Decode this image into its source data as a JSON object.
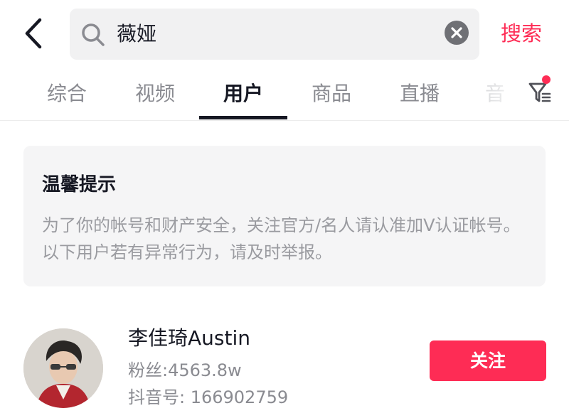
{
  "header": {
    "back_icon": "chevron-left-icon",
    "search": {
      "icon": "search-icon",
      "query": "薇娅",
      "clear_icon": "clear-circle-icon"
    },
    "submit_label": "搜索",
    "accent_color": "#fe2c55"
  },
  "tabs": {
    "items": [
      {
        "label": "综合",
        "active": false
      },
      {
        "label": "视频",
        "active": false
      },
      {
        "label": "用户",
        "active": true
      },
      {
        "label": "商品",
        "active": false
      },
      {
        "label": "直播",
        "active": false
      },
      {
        "label": "音",
        "active": false
      }
    ],
    "filter_icon": "filter-icon",
    "filter_badge": true
  },
  "notice": {
    "title": "温馨提示",
    "body": "为了你的帐号和财产安全，关注官方/名人请认准加V认证帐号。以下用户若有异常行为，请及时举报。"
  },
  "results": [
    {
      "name": "李佳琦Austin",
      "fans": "粉丝:4563.8w",
      "douyin_id": "抖音号: 166902759",
      "follow_label": "关注"
    }
  ]
}
